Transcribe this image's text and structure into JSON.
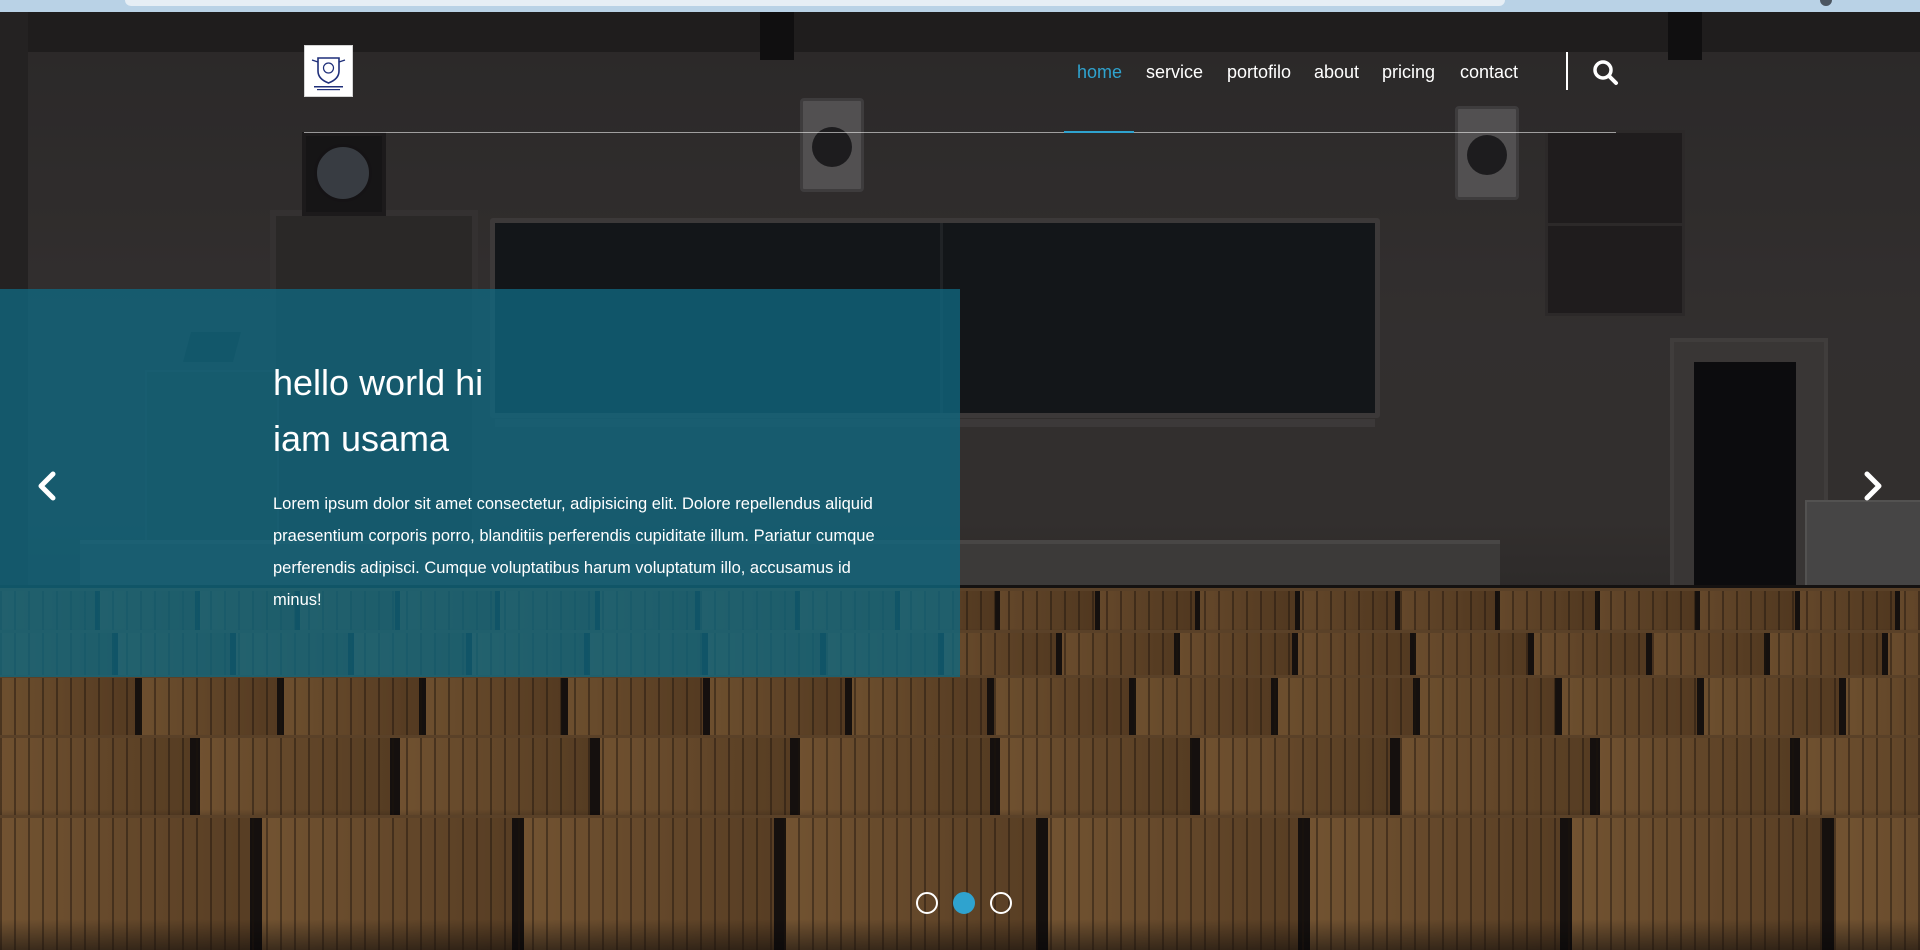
{
  "header": {
    "logo_alt": "school crest logo",
    "nav": [
      {
        "label": "home",
        "active": true
      },
      {
        "label": "service",
        "active": false
      },
      {
        "label": "portofilo",
        "active": false
      },
      {
        "label": "about",
        "active": false
      },
      {
        "label": "pricing",
        "active": false
      },
      {
        "label": "contact",
        "active": false
      }
    ],
    "search_icon": "search-icon"
  },
  "hero": {
    "title_line1": "hello world hi",
    "title_line2": "iam usama",
    "body": "Lorem ipsum dolor sit amet consectetur, adipisicing elit. Dolore repellendus aliquid praesentium corporis porro, blanditiis perferendis cupiditate illum. Pariatur cumque perferendis adipisci. Cumque voluptatibus harum voluptatum illo, accusamus id minus!",
    "prev_icon": "chevron-left-icon",
    "next_icon": "chevron-right-icon",
    "slides_total": 3,
    "active_slide": 2
  },
  "colors": {
    "accent": "#2fa3cf",
    "caption_bg": "#106880",
    "text": "#ffffff"
  }
}
